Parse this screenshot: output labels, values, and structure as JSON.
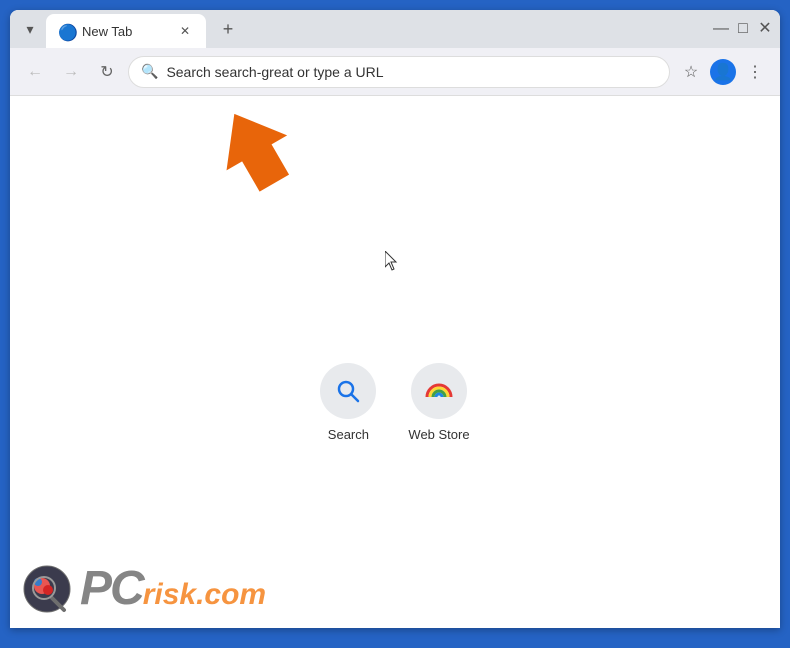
{
  "titleBar": {
    "tab": {
      "title": "New Tab",
      "favicon": "🔵"
    },
    "newTabLabel": "+",
    "dropdownLabel": "▾",
    "minimizeLabel": "—",
    "maximizeLabel": "□",
    "closeLabel": "✕"
  },
  "navBar": {
    "backLabel": "←",
    "forwardLabel": "→",
    "reloadLabel": "↻",
    "addressPlaceholder": "Search search-great or type a URL",
    "addressValue": "Search search-great or type a URL",
    "bookmarkLabel": "☆",
    "profileLabel": "👤",
    "menuLabel": "⋮"
  },
  "shortcuts": [
    {
      "label": "Search",
      "type": "search"
    },
    {
      "label": "Web Store",
      "type": "webstore"
    }
  ],
  "watermark": {
    "text": "PC",
    "suffix": "risk.com"
  }
}
